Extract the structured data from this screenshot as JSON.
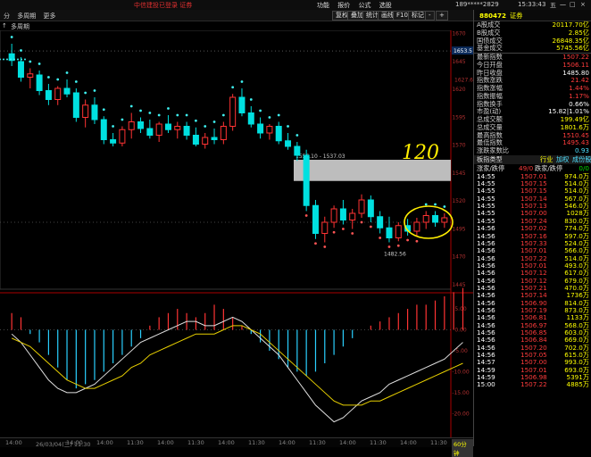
{
  "window": {
    "title": "中信建投已登录  证券",
    "menu": [
      "功能",
      "报价",
      "公式",
      "选股"
    ],
    "account": "189*****2829",
    "time": "15:33:43",
    "win_buttons": [
      "五",
      "一",
      "□",
      "×"
    ]
  },
  "toolbar": {
    "left_items": [
      "分",
      "多周期",
      "更多"
    ],
    "buttons": [
      "复权",
      "叠加",
      "统计",
      "画线",
      "F10",
      "标记",
      "-",
      "+"
    ]
  },
  "indicator_bar": {
    "left_items": [
      "↑",
      "多周期"
    ]
  },
  "chart_data": {
    "type": "candlestick",
    "price_axis_labels": [
      "1670",
      "1645",
      "1620",
      "1595",
      "1570",
      "1545",
      "1520",
      "1495",
      "1470",
      "1445"
    ],
    "price_labels_right": [
      "1653.5",
      "1627.60"
    ],
    "macd_axis_labels": [
      "5.00",
      "0.00",
      "-5.00",
      "-10.00",
      "-15.00",
      "-20.00"
    ],
    "annotations": {
      "range_label": "1556.10 - 1537.03",
      "low_label": "1482.56",
      "handwriting": "120"
    },
    "time_labels": [
      "14:00",
      "26/03/04(三) 11:30",
      "14:00",
      "14:00",
      "11:30",
      "14:00",
      "11:30",
      "14:00",
      "11:30",
      "14:00",
      "11:30",
      "14:00",
      "11:30",
      "14:00",
      "11:30"
    ],
    "period_button": "60分钟",
    "candles": [
      {
        "o": 1651,
        "h": 1660,
        "l": 1640,
        "c": 1645
      },
      {
        "o": 1644,
        "h": 1648,
        "l": 1626,
        "c": 1630
      },
      {
        "o": 1630,
        "h": 1638,
        "l": 1620,
        "c": 1633
      },
      {
        "o": 1632,
        "h": 1636,
        "l": 1614,
        "c": 1618
      },
      {
        "o": 1618,
        "h": 1624,
        "l": 1605,
        "c": 1610
      },
      {
        "o": 1610,
        "h": 1622,
        "l": 1605,
        "c": 1620
      },
      {
        "o": 1620,
        "h": 1628,
        "l": 1612,
        "c": 1615
      },
      {
        "o": 1616,
        "h": 1620,
        "l": 1590,
        "c": 1594
      },
      {
        "o": 1594,
        "h": 1610,
        "l": 1585,
        "c": 1605
      },
      {
        "o": 1605,
        "h": 1612,
        "l": 1588,
        "c": 1592
      },
      {
        "o": 1592,
        "h": 1595,
        "l": 1570,
        "c": 1574
      },
      {
        "o": 1574,
        "h": 1580,
        "l": 1568,
        "c": 1571
      },
      {
        "o": 1571,
        "h": 1586,
        "l": 1568,
        "c": 1583
      },
      {
        "o": 1583,
        "h": 1598,
        "l": 1575,
        "c": 1590
      },
      {
        "o": 1590,
        "h": 1594,
        "l": 1580,
        "c": 1584
      },
      {
        "o": 1584,
        "h": 1592,
        "l": 1575,
        "c": 1578
      },
      {
        "o": 1578,
        "h": 1590,
        "l": 1572,
        "c": 1588
      },
      {
        "o": 1588,
        "h": 1596,
        "l": 1580,
        "c": 1583
      },
      {
        "o": 1583,
        "h": 1590,
        "l": 1575,
        "c": 1586
      },
      {
        "o": 1586,
        "h": 1590,
        "l": 1574,
        "c": 1578
      },
      {
        "o": 1578,
        "h": 1585,
        "l": 1568,
        "c": 1570
      },
      {
        "o": 1570,
        "h": 1580,
        "l": 1566,
        "c": 1576
      },
      {
        "o": 1576,
        "h": 1584,
        "l": 1570,
        "c": 1574
      },
      {
        "o": 1574,
        "h": 1590,
        "l": 1570,
        "c": 1586
      },
      {
        "o": 1586,
        "h": 1615,
        "l": 1582,
        "c": 1612
      },
      {
        "o": 1612,
        "h": 1620,
        "l": 1595,
        "c": 1598
      },
      {
        "o": 1598,
        "h": 1604,
        "l": 1585,
        "c": 1588
      },
      {
        "o": 1588,
        "h": 1594,
        "l": 1575,
        "c": 1580
      },
      {
        "o": 1580,
        "h": 1588,
        "l": 1574,
        "c": 1586
      },
      {
        "o": 1586,
        "h": 1590,
        "l": 1570,
        "c": 1573
      },
      {
        "o": 1573,
        "h": 1580,
        "l": 1565,
        "c": 1568
      },
      {
        "o": 1568,
        "h": 1572,
        "l": 1555,
        "c": 1560
      },
      {
        "o": 1560,
        "h": 1565,
        "l": 1510,
        "c": 1515
      },
      {
        "o": 1515,
        "h": 1520,
        "l": 1485,
        "c": 1490
      },
      {
        "o": 1490,
        "h": 1505,
        "l": 1482,
        "c": 1500
      },
      {
        "o": 1500,
        "h": 1515,
        "l": 1495,
        "c": 1512
      },
      {
        "o": 1512,
        "h": 1520,
        "l": 1498,
        "c": 1502
      },
      {
        "o": 1502,
        "h": 1512,
        "l": 1494,
        "c": 1508
      },
      {
        "o": 1508,
        "h": 1525,
        "l": 1504,
        "c": 1520
      },
      {
        "o": 1520,
        "h": 1524,
        "l": 1500,
        "c": 1505
      },
      {
        "o": 1505,
        "h": 1510,
        "l": 1490,
        "c": 1495
      },
      {
        "o": 1495,
        "h": 1505,
        "l": 1482,
        "c": 1486
      },
      {
        "o": 1486,
        "h": 1500,
        "l": 1483,
        "c": 1497
      },
      {
        "o": 1497,
        "h": 1503,
        "l": 1488,
        "c": 1492
      },
      {
        "o": 1492,
        "h": 1504,
        "l": 1487,
        "c": 1500
      },
      {
        "o": 1500,
        "h": 1510,
        "l": 1494,
        "c": 1506
      },
      {
        "o": 1506,
        "h": 1510,
        "l": 1496,
        "c": 1500
      },
      {
        "o": 1500,
        "h": 1508,
        "l": 1495,
        "c": 1504
      }
    ],
    "macd_bars": [
      4,
      3,
      -1,
      -3,
      -6,
      -9,
      -12,
      -14,
      -13,
      -12,
      -10,
      -8,
      -6,
      -4,
      -2,
      1,
      3,
      4,
      5,
      4,
      3,
      4,
      6,
      5,
      3,
      1,
      -1,
      -3,
      -5,
      -7,
      -9,
      -10,
      -11,
      -10,
      -8,
      -6,
      -4,
      -2,
      0,
      1,
      2,
      3,
      4,
      5,
      6,
      6,
      7,
      8,
      9,
      10
    ],
    "dif_line": [
      -1,
      -3,
      -6,
      -9,
      -12,
      -14,
      -15,
      -15,
      -14,
      -13,
      -11,
      -9,
      -7,
      -5,
      -3,
      -2,
      -1,
      0,
      1,
      2,
      2,
      1,
      1,
      2,
      3,
      2,
      0,
      -2,
      -4,
      -6,
      -9,
      -12,
      -15,
      -18,
      -20,
      -22,
      -21,
      -19,
      -17,
      -16,
      -15,
      -13,
      -12,
      -11,
      -10,
      -9,
      -8,
      -7,
      -5,
      -3
    ],
    "dea_line": [
      -2,
      -3,
      -4,
      -6,
      -8,
      -10,
      -12,
      -13,
      -14,
      -14,
      -13,
      -12,
      -11,
      -9,
      -8,
      -6,
      -5,
      -4,
      -3,
      -2,
      -1,
      -1,
      -1,
      0,
      1,
      1,
      0,
      -1,
      -3,
      -5,
      -7,
      -9,
      -11,
      -13,
      -15,
      -17,
      -18,
      -18,
      -18,
      -17,
      -17,
      -16,
      -15,
      -14,
      -13,
      -12,
      -11,
      -10,
      -9,
      -8
    ]
  },
  "panel": {
    "code": "880472",
    "name": "证券",
    "market_rows": [
      {
        "k": "A股成交",
        "v": "20117.70亿",
        "c": "yel"
      },
      {
        "k": "B股成交",
        "v": "2.85亿",
        "c": "yel"
      },
      {
        "k": "国债成交",
        "v": "26848.35亿",
        "c": "yel"
      },
      {
        "k": "基金成交",
        "v": "5745.56亿",
        "c": "yel"
      }
    ],
    "index_rows": [
      {
        "k": "最新指数",
        "v": "1507.22",
        "c": "red"
      },
      {
        "k": "今日开盘",
        "v": "1506.11",
        "c": "red"
      },
      {
        "k": "昨日收盘",
        "v": "1485.80",
        "c": "wht"
      },
      {
        "k": "指数涨跌",
        "v": "21.42",
        "c": "red"
      },
      {
        "k": "指数涨幅",
        "v": "1.44%",
        "c": "red"
      },
      {
        "k": "指数振幅",
        "v": "1.17%",
        "c": "red"
      },
      {
        "k": "指数换手",
        "v": "0.66%",
        "c": "wht"
      },
      {
        "k": "市盈(动)",
        "v": "15.82|1.01%",
        "c": "wht"
      },
      {
        "k": "总成交额",
        "v": "199.49亿",
        "c": "yel"
      },
      {
        "k": "总成交量",
        "v": "1801.6万",
        "c": "yel"
      },
      {
        "k": "最高指数",
        "v": "1510.45",
        "c": "red"
      },
      {
        "k": "最低指数",
        "v": "1495.43",
        "c": "red"
      },
      {
        "k": "涨跌家数比",
        "v": "0.93",
        "c": "cyn"
      }
    ],
    "block_type_label": "板指类型",
    "block_type_tabs": [
      "行业",
      "加权",
      "成份股"
    ],
    "updown_label": "涨家/跌停",
    "updown_value": "49/0",
    "updown_label2": "跌家/跌停",
    "updown_value2": "0/0",
    "ticks": [
      {
        "t": "14:55",
        "p": "1507.01",
        "v": "974.0万",
        "c": "red"
      },
      {
        "t": "14:55",
        "p": "1507.15",
        "v": "514.0万",
        "c": "red"
      },
      {
        "t": "14:55",
        "p": "1507.15",
        "v": "514.0万",
        "c": "red"
      },
      {
        "t": "14:55",
        "p": "1507.14",
        "v": "567.0万",
        "c": "red"
      },
      {
        "t": "14:55",
        "p": "1507.13",
        "v": "546.0万",
        "c": "red"
      },
      {
        "t": "14:55",
        "p": "1507.00",
        "v": "1028万",
        "c": "red"
      },
      {
        "t": "14:55",
        "p": "1507.24",
        "v": "830.0万",
        "c": "red"
      },
      {
        "t": "14:56",
        "p": "1507.02",
        "v": "774.0万",
        "c": "red"
      },
      {
        "t": "14:56",
        "p": "1507.16",
        "v": "597.0万",
        "c": "red"
      },
      {
        "t": "14:56",
        "p": "1507.33",
        "v": "524.0万",
        "c": "red"
      },
      {
        "t": "14:56",
        "p": "1507.01",
        "v": "566.0万",
        "c": "red"
      },
      {
        "t": "14:56",
        "p": "1507.22",
        "v": "514.0万",
        "c": "red"
      },
      {
        "t": "14:56",
        "p": "1507.01",
        "v": "493.0万",
        "c": "red"
      },
      {
        "t": "14:56",
        "p": "1507.12",
        "v": "617.0万",
        "c": "red"
      },
      {
        "t": "14:56",
        "p": "1507.12",
        "v": "679.0万",
        "c": "red"
      },
      {
        "t": "14:56",
        "p": "1507.21",
        "v": "470.0万",
        "c": "red"
      },
      {
        "t": "14:56",
        "p": "1507.14",
        "v": "1736万",
        "c": "red"
      },
      {
        "t": "14:56",
        "p": "1506.90",
        "v": "814.0万",
        "c": "red"
      },
      {
        "t": "14:56",
        "p": "1507.19",
        "v": "873.0万",
        "c": "red"
      },
      {
        "t": "14:56",
        "p": "1506.81",
        "v": "1133万",
        "c": "red"
      },
      {
        "t": "14:56",
        "p": "1506.97",
        "v": "568.0万",
        "c": "red"
      },
      {
        "t": "14:56",
        "p": "1506.85",
        "v": "603.0万",
        "c": "red"
      },
      {
        "t": "14:56",
        "p": "1506.84",
        "v": "669.0万",
        "c": "red"
      },
      {
        "t": "14:56",
        "p": "1507.20",
        "v": "702.0万",
        "c": "red"
      },
      {
        "t": "14:56",
        "p": "1507.05",
        "v": "615.0万",
        "c": "red"
      },
      {
        "t": "14:57",
        "p": "1507.00",
        "v": "993.0万",
        "c": "red"
      },
      {
        "t": "14:59",
        "p": "1507.01",
        "v": "693.0万",
        "c": "red"
      },
      {
        "t": "14:59",
        "p": "1506.98",
        "v": "5391万",
        "c": "red"
      },
      {
        "t": "15:00",
        "p": "1507.22",
        "v": "4885万",
        "c": "red"
      }
    ]
  }
}
